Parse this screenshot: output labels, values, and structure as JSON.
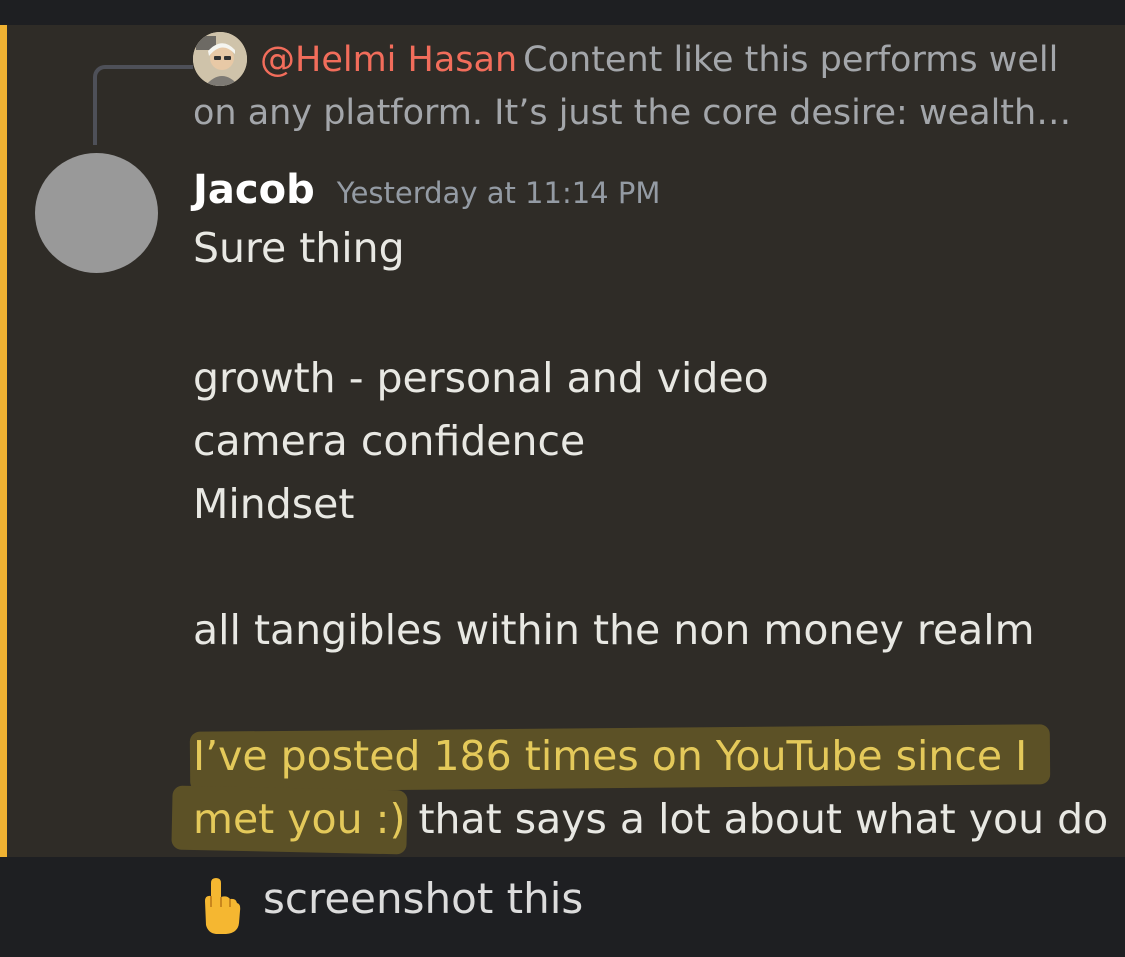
{
  "reply": {
    "mention": "@Helmi Hasan",
    "preview_line1": "Content like this performs well",
    "preview_line2": "on any platform. It’s just the core desire: wealth…"
  },
  "message": {
    "author": "Jacob",
    "timestamp": "Yesterday at 11:14 PM",
    "lines": [
      "Sure thing",
      "growth - personal and video",
      "camera confidence",
      "Mindset",
      "all tangibles within the non money realm"
    ],
    "highlighted": {
      "line1": "I’ve posted 186 times on YouTube since I",
      "line2_highlighted": "met you :)",
      "line2_rest": " that says a lot about what you do"
    }
  },
  "caption": {
    "icon": "pointing-down-emoji",
    "text": "screenshot this"
  },
  "colors": {
    "accent_bar": "#f0b232",
    "mention": "#f26d5b",
    "highlight": "#e4c95a"
  }
}
